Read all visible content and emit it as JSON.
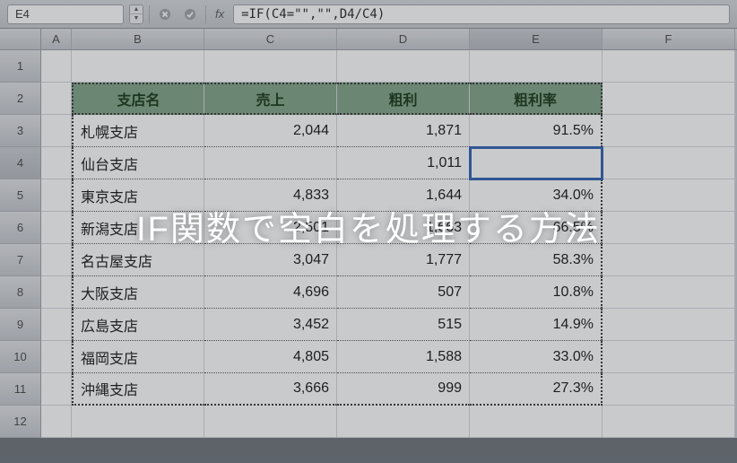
{
  "formula_bar": {
    "cell_ref": "E4",
    "formula": "=IF(C4=\"\",\"\",D4/C4)"
  },
  "columns": [
    "A",
    "B",
    "C",
    "D",
    "E",
    "F"
  ],
  "row_numbers": [
    "1",
    "2",
    "3",
    "4",
    "5",
    "6",
    "7",
    "8",
    "9",
    "10",
    "11",
    "12"
  ],
  "active_row": "4",
  "active_col": "E",
  "selected_cell": "E4",
  "table": {
    "headers": {
      "branch": "支店名",
      "sales": "売上",
      "gross": "粗利",
      "margin": "粗利率"
    },
    "rows": [
      {
        "branch": "札幌支店",
        "sales": "2,044",
        "gross": "1,871",
        "margin": "91.5%"
      },
      {
        "branch": "仙台支店",
        "sales": "",
        "gross": "1,011",
        "margin": ""
      },
      {
        "branch": "東京支店",
        "sales": "4,833",
        "gross": "1,644",
        "margin": "34.0%"
      },
      {
        "branch": "新潟支店",
        "sales": "2,501",
        "gross": "1,663",
        "margin": "66.5%"
      },
      {
        "branch": "名古屋支店",
        "sales": "3,047",
        "gross": "1,777",
        "margin": "58.3%"
      },
      {
        "branch": "大阪支店",
        "sales": "4,696",
        "gross": "507",
        "margin": "10.8%"
      },
      {
        "branch": "広島支店",
        "sales": "3,452",
        "gross": "515",
        "margin": "14.9%"
      },
      {
        "branch": "福岡支店",
        "sales": "4,805",
        "gross": "1,588",
        "margin": "33.0%"
      },
      {
        "branch": "沖縄支店",
        "sales": "3,666",
        "gross": "999",
        "margin": "27.3%"
      }
    ]
  },
  "overlay_title": "IF関数で空白を処理する方法"
}
